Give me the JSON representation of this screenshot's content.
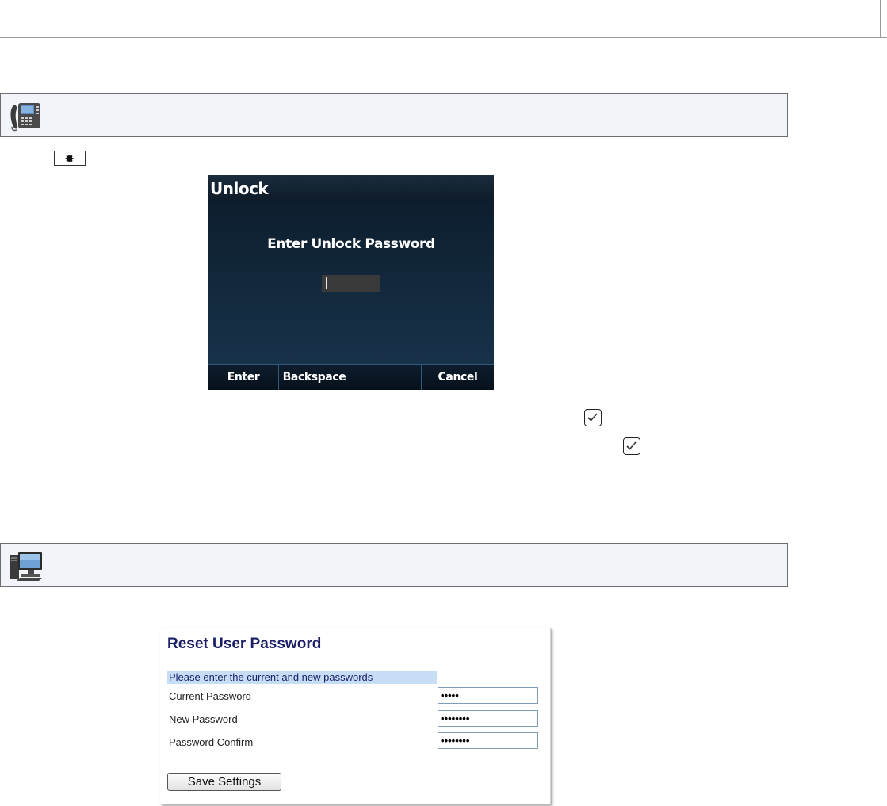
{
  "phone_screen": {
    "title": "Unlock",
    "prompt": "Enter Unlock Password",
    "softkeys": [
      "Enter",
      "Backspace",
      "",
      "Cancel"
    ]
  },
  "web_ui": {
    "title": "Reset User Password",
    "subheading": "Please enter the current and new passwords",
    "fields": [
      {
        "label": "Current Password",
        "value": "•••••"
      },
      {
        "label": "New Password",
        "value": "••••••••"
      },
      {
        "label": "Password Confirm",
        "value": "••••••••"
      }
    ],
    "save_button": "Save Settings"
  },
  "icons": {
    "phone_method": "ip-phone-icon",
    "web_method": "desktop-computer-icon",
    "settings_key": "gear-icon",
    "confirm_key": "checkmark-key-icon"
  }
}
